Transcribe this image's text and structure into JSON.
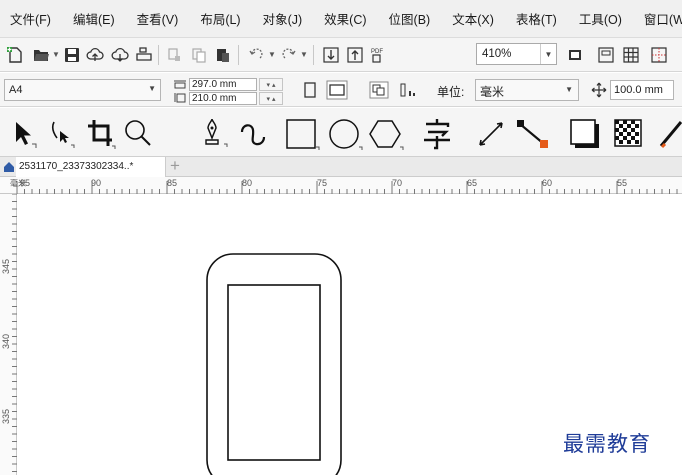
{
  "menu": {
    "items": [
      "文件(F)",
      "编辑(E)",
      "查看(V)",
      "布局(L)",
      "对象(J)",
      "效果(C)",
      "位图(B)",
      "文本(X)",
      "表格(T)",
      "工具(O)",
      "窗口(W)"
    ]
  },
  "toolbar": {
    "zoom_value": "410%",
    "pdf_label": "PDF"
  },
  "propbar": {
    "page_size": "A4",
    "width_value": "297.0 mm",
    "height_value": "210.0 mm",
    "unit_label": "单位:",
    "unit_value": "毫米",
    "nudge_value": "100.0 mm"
  },
  "doc": {
    "tab_title": "2531170_23373302334..*",
    "add_tab": "+"
  },
  "ruler": {
    "h_labels": [
      "95",
      "90",
      "85",
      "80",
      "75",
      "70",
      "65",
      "60",
      "55"
    ],
    "v_labels": [
      "345",
      "340",
      "335"
    ],
    "unit_mark": "毫米"
  },
  "watermark": "最需教育"
}
